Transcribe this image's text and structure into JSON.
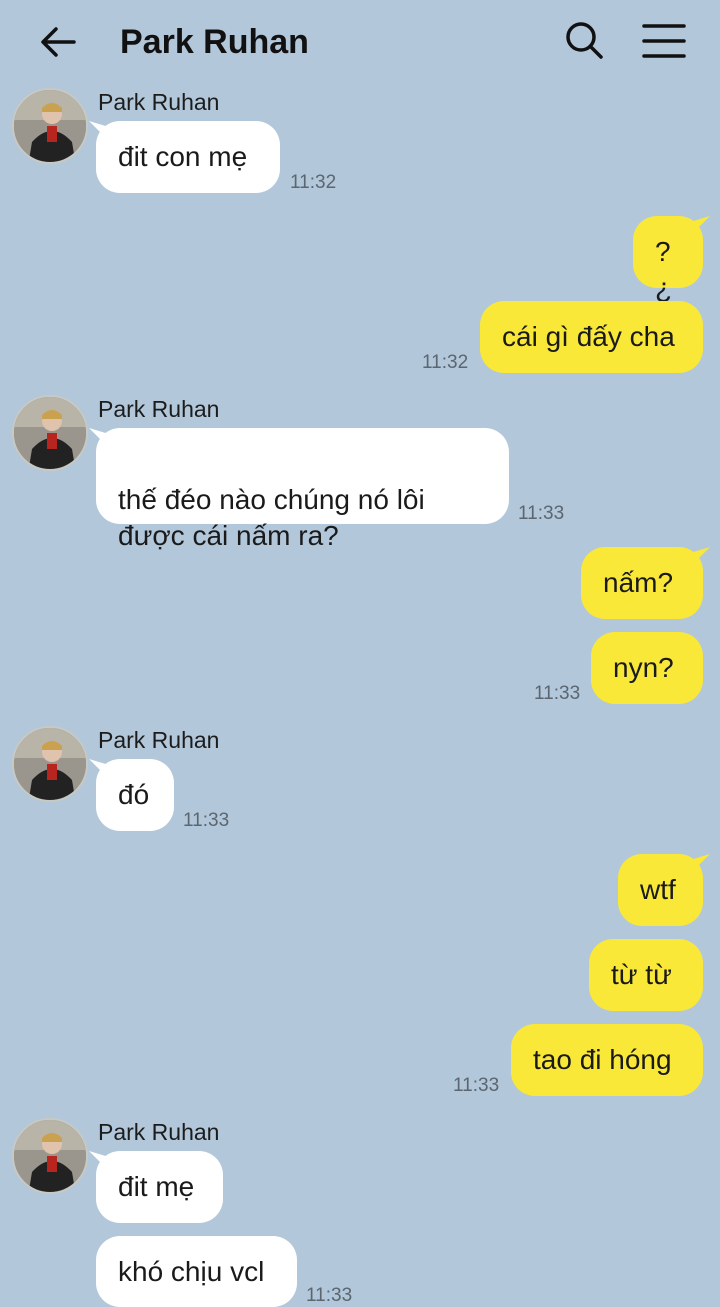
{
  "header": {
    "title": "Park Ruhan"
  },
  "icons": {
    "back": "arrow-left-icon",
    "search": "search-icon",
    "menu": "hamburger-menu-icon"
  },
  "colors": {
    "background": "#b2c7da",
    "incoming_bubble": "#ffffff",
    "outgoing_bubble": "#fae838"
  },
  "groups": [
    {
      "direction": "in",
      "sender": "Park Ruhan",
      "time": "11:32",
      "messages": [
        "đit con mẹ"
      ]
    },
    {
      "direction": "out",
      "time": "11:32",
      "messages": [
        "?¿",
        "cái gì đấy cha"
      ]
    },
    {
      "direction": "in",
      "sender": "Park Ruhan",
      "time": "11:33",
      "messages": [
        "thế đéo nào chúng nó lôi\nđược cái nấm ra?"
      ]
    },
    {
      "direction": "out",
      "time": "11:33",
      "messages": [
        "nấm?",
        "nyn?"
      ]
    },
    {
      "direction": "in",
      "sender": "Park Ruhan",
      "time": "11:33",
      "messages": [
        "đó"
      ]
    },
    {
      "direction": "out",
      "time": "11:33",
      "messages": [
        "wtf",
        "từ từ",
        "tao đi hóng"
      ]
    },
    {
      "direction": "in",
      "sender": "Park Ruhan",
      "time": "11:33",
      "messages": [
        "đit mẹ",
        "khó chịu vcl"
      ]
    }
  ]
}
